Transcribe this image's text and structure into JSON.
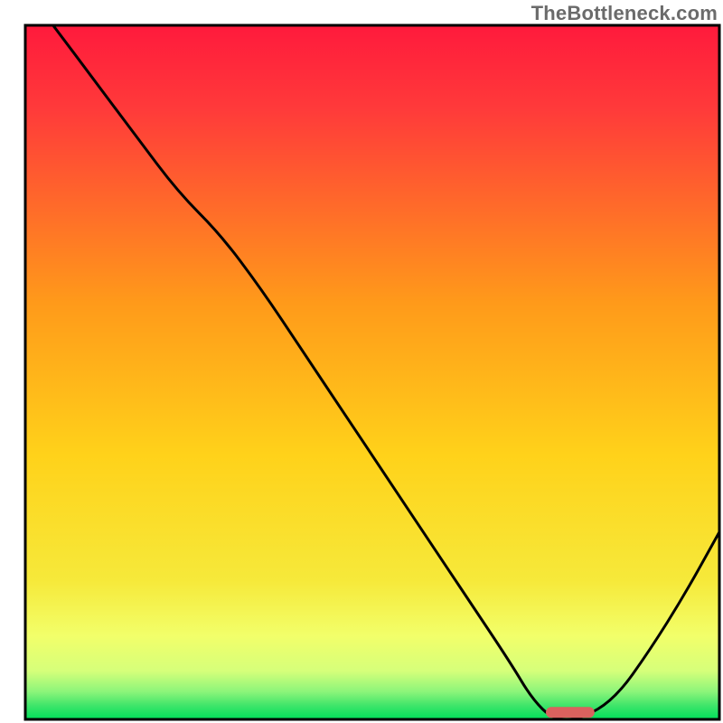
{
  "watermark": {
    "text": "TheBottleneck.com"
  },
  "chart_data": {
    "type": "line",
    "title": "",
    "xlabel": "",
    "ylabel": "",
    "x_range": [
      0,
      100
    ],
    "y_range": [
      0,
      100
    ],
    "series": [
      {
        "name": "bottleneck-curve",
        "x": [
          4,
          10,
          16,
          22,
          28,
          34,
          40,
          46,
          52,
          58,
          64,
          70,
          73,
          76,
          80,
          85,
          90,
          95,
          100
        ],
        "y": [
          100,
          92,
          84,
          76,
          70,
          62,
          53,
          44,
          35,
          26,
          17,
          8,
          3,
          0,
          0,
          3,
          10,
          18,
          27
        ]
      }
    ],
    "marker": {
      "name": "optimal-range-marker",
      "x_start": 75,
      "x_end": 82,
      "y": 1,
      "color": "#d9625e"
    },
    "background_gradient": {
      "top": "#ff1a3c",
      "mid": "#ffd21a",
      "green_band_top": "#ecff7a",
      "green_band_bottom": "#00e05a"
    },
    "frame": {
      "stroke": "#000000",
      "stroke_width": 3,
      "inset_top": 28,
      "inset_left": 28,
      "inset_right": 4,
      "inset_bottom": 4
    }
  }
}
